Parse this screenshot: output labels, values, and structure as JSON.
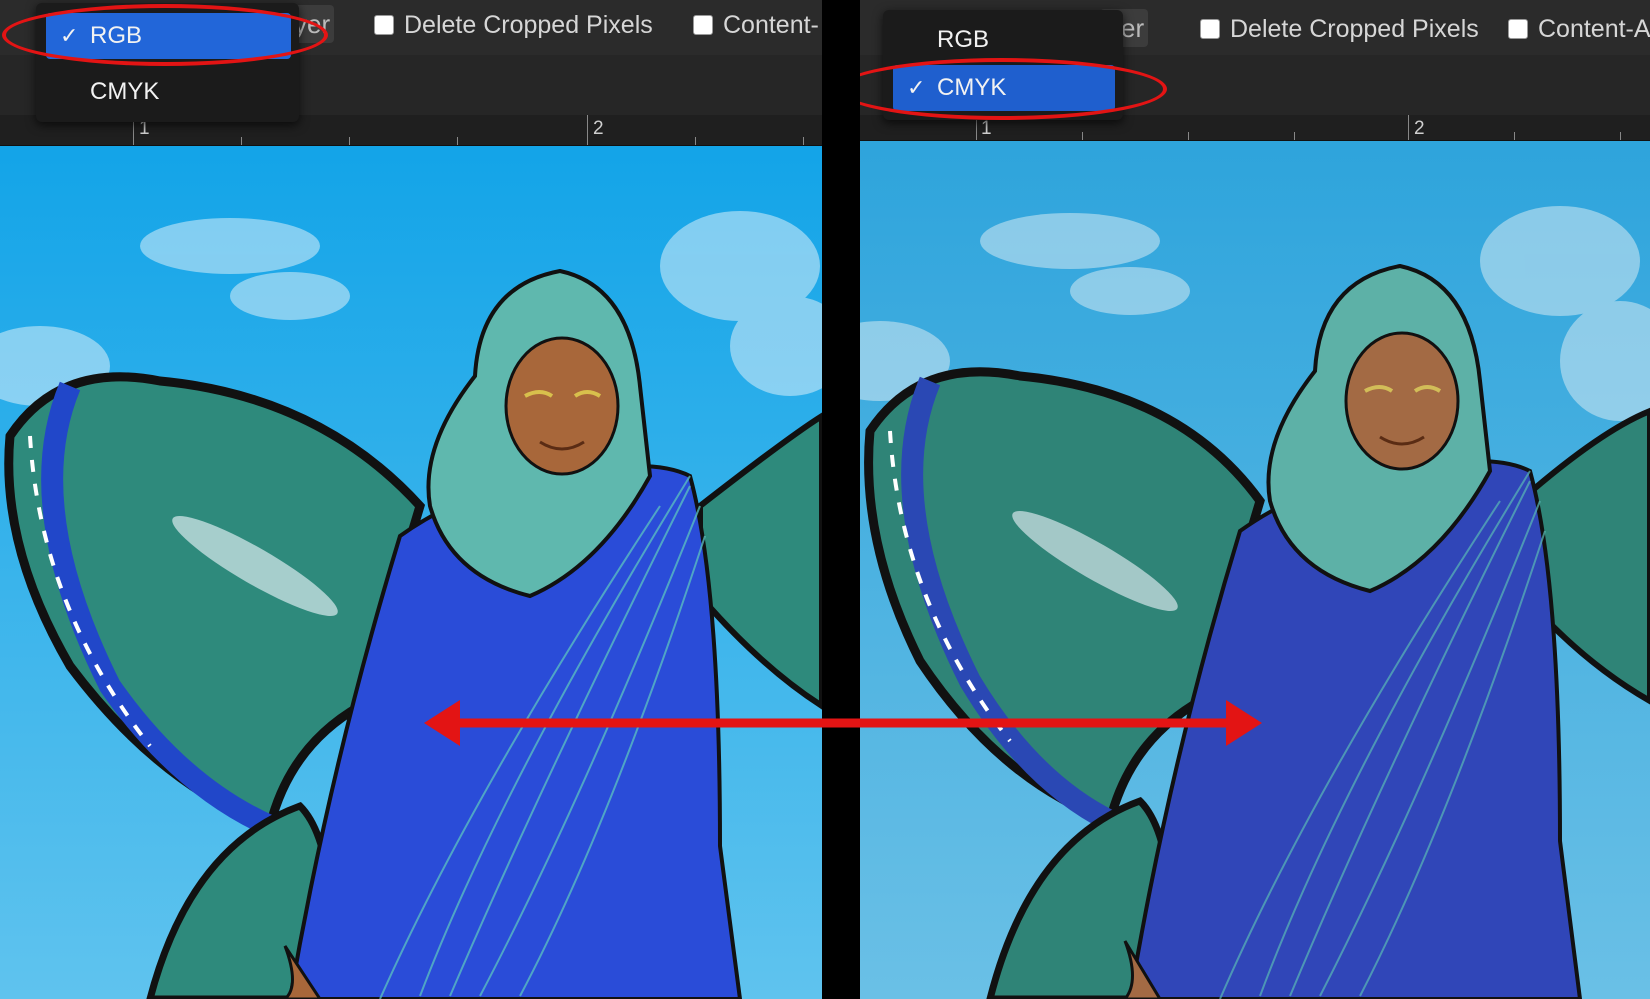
{
  "panels": [
    {
      "id": "left",
      "color_mode_menu": {
        "items": [
          {
            "label": "RGB",
            "checked": true,
            "check_glyph": "✓"
          },
          {
            "label": "CMYK",
            "checked": false,
            "check_glyph": ""
          }
        ]
      },
      "toolbar": {
        "layer_partial": "yer",
        "delete_cropped_pixels_label": "Delete Cropped Pixels",
        "content_aware_label": "Content-"
      },
      "ruler_numbers": [
        "1",
        "2"
      ],
      "artwork_tint": "rgb"
    },
    {
      "id": "right",
      "color_mode_menu": {
        "items": [
          {
            "label": "RGB",
            "checked": false,
            "check_glyph": ""
          },
          {
            "label": "CMYK",
            "checked": true,
            "check_glyph": "✓"
          }
        ]
      },
      "toolbar": {
        "layer_partial": "yer",
        "delete_cropped_pixels_label": "Delete Cropped Pixels",
        "content_aware_label": "Content-A"
      },
      "ruler_numbers": [
        "1",
        "2"
      ],
      "artwork_tint": "cmyk"
    }
  ],
  "colors": {
    "selection_blue": "#2266d9",
    "annotation_red": "#e31414",
    "sky_rgb": "#1aa7e6",
    "sky_cmyk": "#3aa8dd",
    "robe_rgb": "#2a4cd8",
    "robe_cmyk": "#3046b8",
    "wing_teal": "#2e8a7c",
    "hijab_teal": "#5fb8ae",
    "skin": "#a8673a"
  },
  "annotations": {
    "highlight": "red-ellipse-around-selected-mode",
    "compare_arrow": "double-headed-red-arrow"
  }
}
